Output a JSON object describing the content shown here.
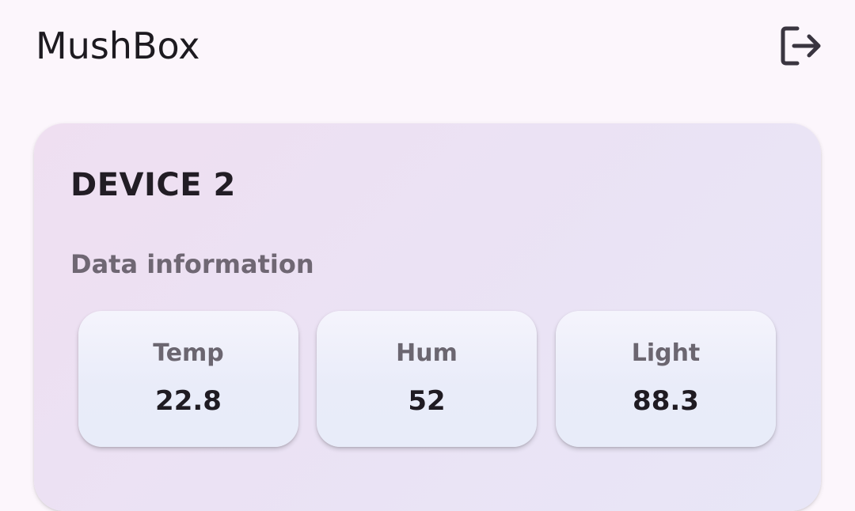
{
  "app": {
    "title": "MushBox",
    "logout_icon": "logout-icon"
  },
  "device": {
    "name": "DEVICE 2",
    "section_label": "Data information",
    "metrics": [
      {
        "label": "Temp",
        "value": "22.8"
      },
      {
        "label": "Hum",
        "value": "52"
      },
      {
        "label": "Light",
        "value": "88.3"
      }
    ]
  },
  "colors": {
    "background": "#fcf6fc",
    "card_background": "#ece2f3",
    "metric_background": "#ecedfa",
    "title_text": "#1d1a20",
    "muted_text": "#6f6773"
  }
}
